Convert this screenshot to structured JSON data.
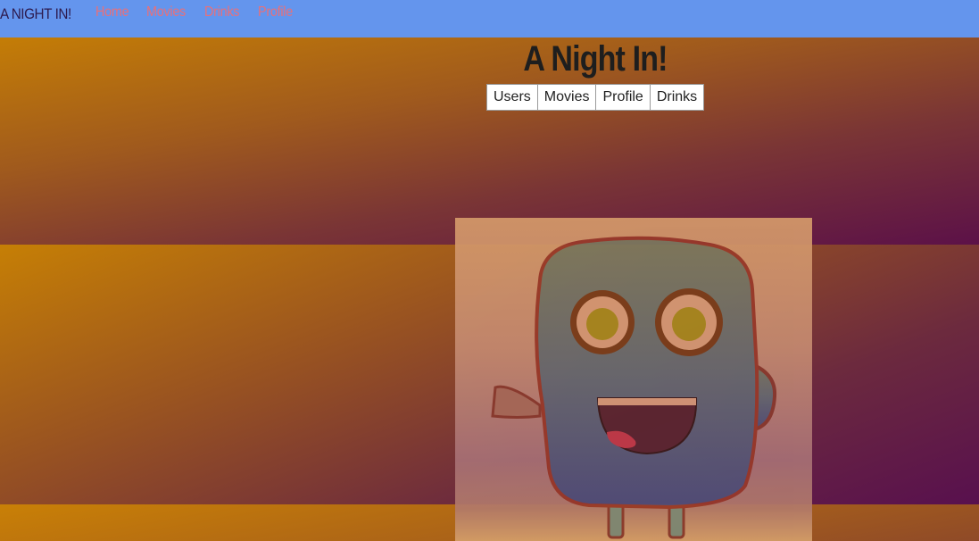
{
  "navbar": {
    "brand": "A NIGHT IN!",
    "links": [
      "Home",
      "Movies",
      "Drinks",
      "Profile"
    ]
  },
  "header": {
    "title": "A Night In!",
    "buttons": [
      "Users",
      "Movies",
      "Profile",
      "Drinks"
    ]
  },
  "colors": {
    "navbar": "#6495ed",
    "nav_link": "#e8707a",
    "gradient_start": "#c67f05",
    "gradient_end": "#58104e"
  },
  "hero": {
    "image": "monster-mascot-illustration"
  }
}
